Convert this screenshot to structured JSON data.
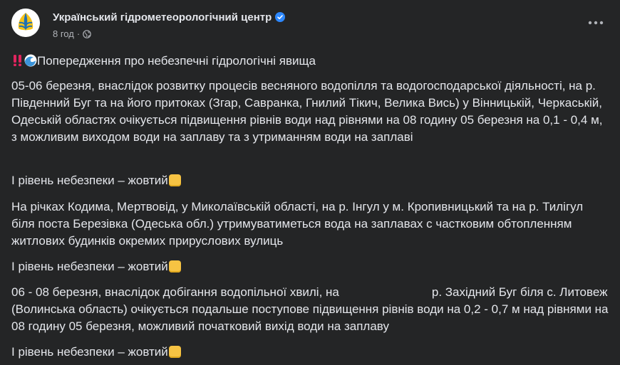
{
  "page": {
    "name": "Український гідрометеорологічний центр",
    "time": "8 год",
    "separator": "·"
  },
  "icons": {
    "verified": "verified-badge-icon",
    "audience": "globe-icon",
    "more": "more-options-icon",
    "alert": "double-exclamation-icon",
    "wave": "water-wave-icon",
    "level": "yellow-square-icon"
  },
  "colors": {
    "background": "#242526",
    "text": "#e4e6eb",
    "secondary": "#b0b3b8",
    "verified": "#2d88ff",
    "level_yellow": "#f6c343"
  },
  "post": {
    "title": "Попередження про небезпечні гідрологічні явища",
    "p1": "05-06 березня, внаслідок розвитку процесів весняного водопілля та водогосподарської діяльності, на р. Південний Буг та на його притоках (Згар, Савранка, Гнилий Тікич, Велика Вись) у Вінницькій, Черкаській, Одеській областях очікується підвищення рівнів води над рівнями на 08 годину 05 березня на 0,1 - 0,4 м, з можливим виходом води на заплаву та з утриманням води на заплаві",
    "level_text": "І рівень небезпеки – жовтий",
    "p2": "На річках Кодима, Мертвовід, у Миколаївській області, на р. Інгул у м. Кропивницький та на р. Тилігул біля поста Березівка (Одеська обл.) утримуватиметься вода на заплавах с частковим обтопленням житлових будинків окремих прируслових вулиць",
    "p3_start": "06 - 08 березня, внаслідок добігання водопільної хвилі, на",
    "p3_end": "р. Західний Буг біля с. Литовеж (Волинська область) очікується подальше поступове підвищення рівнів води на 0,2 - 0,7 м над рівнями на 08 годину 05 березня, можливий початковий вихід води на заплаву"
  }
}
